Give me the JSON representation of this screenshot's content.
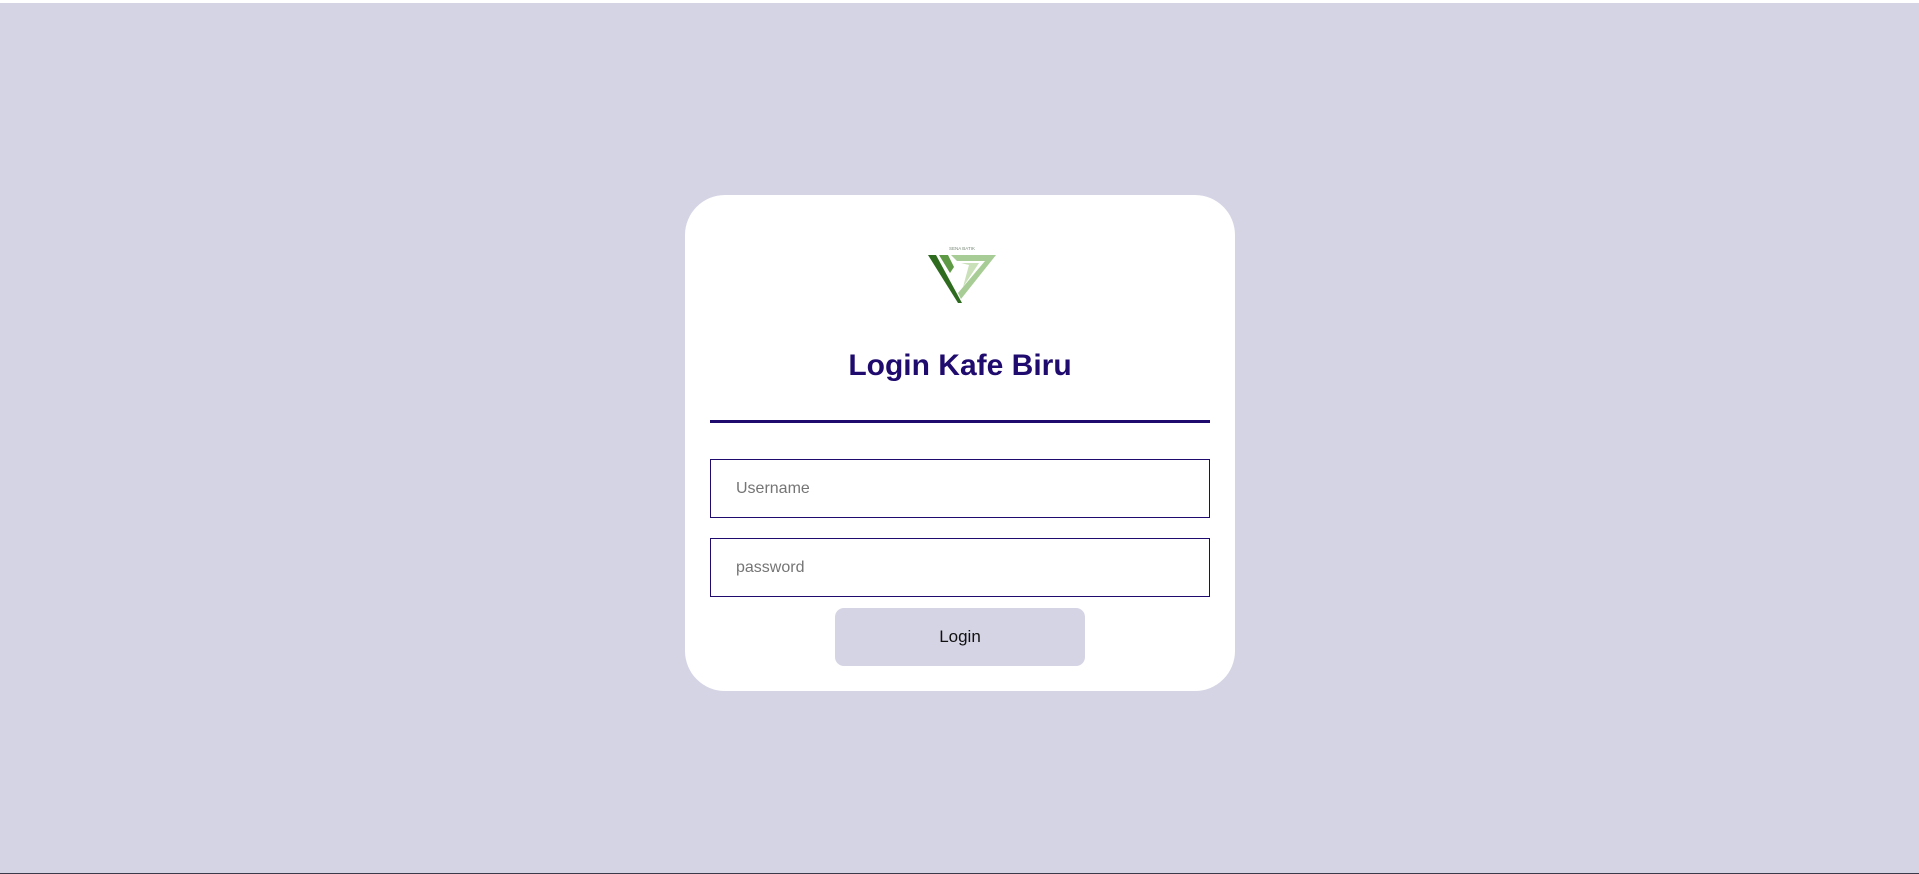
{
  "page": {
    "background_color": "#d5d4e5",
    "accent_color": "#1f0a6e"
  },
  "logo": {
    "icon": "kafe-biru-logo-icon",
    "text": "SENA BATIK"
  },
  "login_form": {
    "title": "Login Kafe Biru",
    "username_placeholder": "Username",
    "username_value": "",
    "password_placeholder": "password",
    "password_value": "",
    "login_label": "Login"
  }
}
